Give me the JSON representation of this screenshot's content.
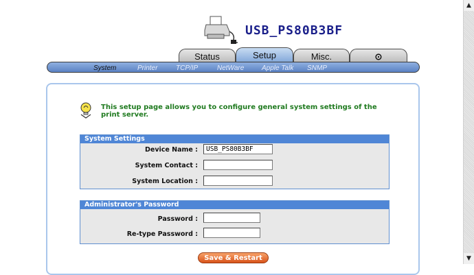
{
  "header": {
    "device_name": "USB_PS80B3BF"
  },
  "tabs": [
    {
      "label": "Status"
    },
    {
      "label": "Setup"
    },
    {
      "label": "Misc."
    },
    {
      "label": "⊙"
    }
  ],
  "subnav": [
    {
      "label": "System"
    },
    {
      "label": "Printer"
    },
    {
      "label": "TCP/IP"
    },
    {
      "label": "NetWare"
    },
    {
      "label": "Apple Talk"
    },
    {
      "label": "SNMP"
    }
  ],
  "info": {
    "text": "This setup page allows you to configure general system settings of the print server."
  },
  "system_settings": {
    "title": "System Settings",
    "device_name_label": "Device Name :",
    "device_name_value": "USB_PS80B3BF",
    "contact_label": "System Contact :",
    "contact_value": "",
    "location_label": "System Location :",
    "location_value": ""
  },
  "admin_password": {
    "title": "Administrator's Password",
    "password_label": "Password :",
    "password_value": "",
    "retype_label": "Re-type Password :",
    "retype_value": ""
  },
  "actions": {
    "save_restart": "Save & Restart"
  }
}
